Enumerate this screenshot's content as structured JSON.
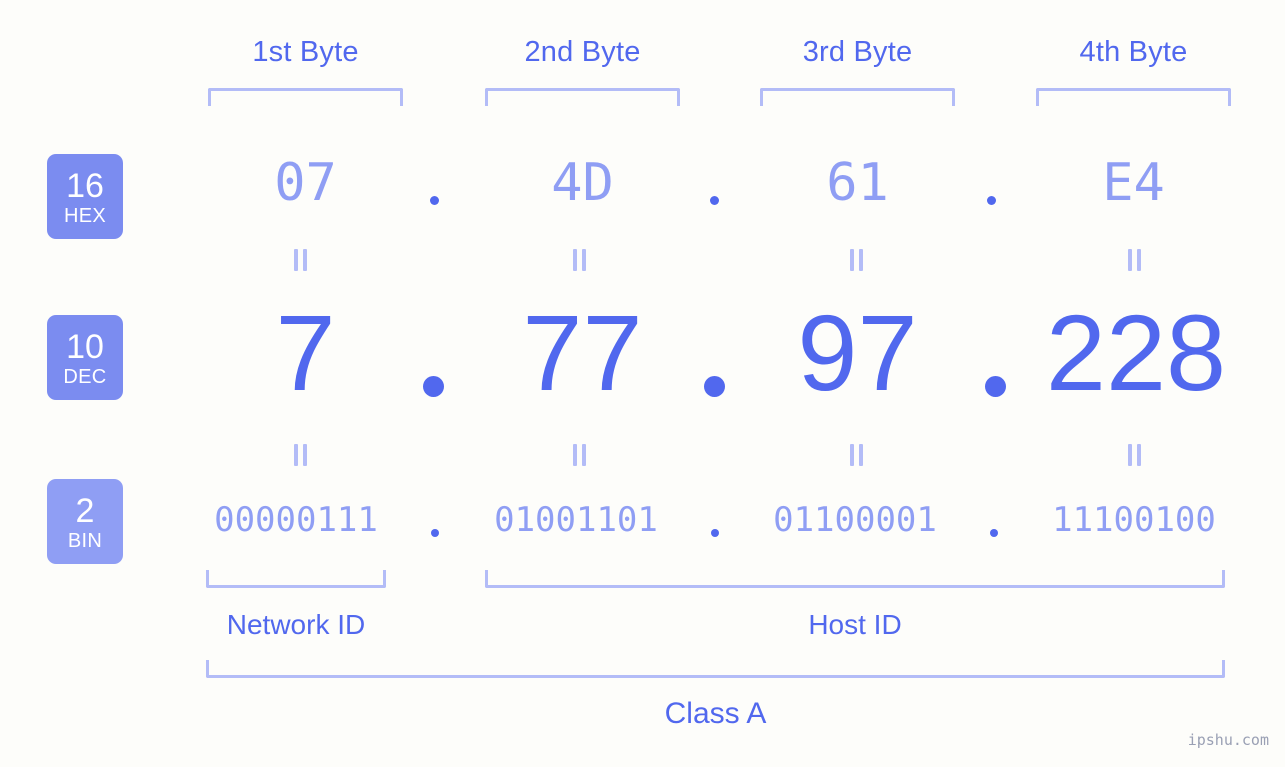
{
  "meta": {
    "watermark": "ipshu.com",
    "background_color": "#fdfdfa",
    "accent_strong": "#5168ee",
    "accent_mid": "#7b8cf0",
    "accent_light": "#b3bcf7"
  },
  "byte_headers": [
    {
      "label": "1st Byte"
    },
    {
      "label": "2nd Byte"
    },
    {
      "label": "3rd Byte"
    },
    {
      "label": "4th Byte"
    }
  ],
  "rows": [
    {
      "badge_number": "16",
      "badge_system": "HEX",
      "values": [
        "07",
        "4D",
        "61",
        "E4"
      ],
      "separator": "."
    },
    {
      "badge_number": "10",
      "badge_system": "DEC",
      "values": [
        "7",
        "77",
        "97",
        "228"
      ],
      "separator": "."
    },
    {
      "badge_number": "2",
      "badge_system": "BIN",
      "values": [
        "00000111",
        "01001101",
        "01100001",
        "11100100"
      ],
      "separator": "."
    }
  ],
  "segments": {
    "network_id": "Network ID",
    "host_id": "Host ID",
    "class": "Class A"
  }
}
